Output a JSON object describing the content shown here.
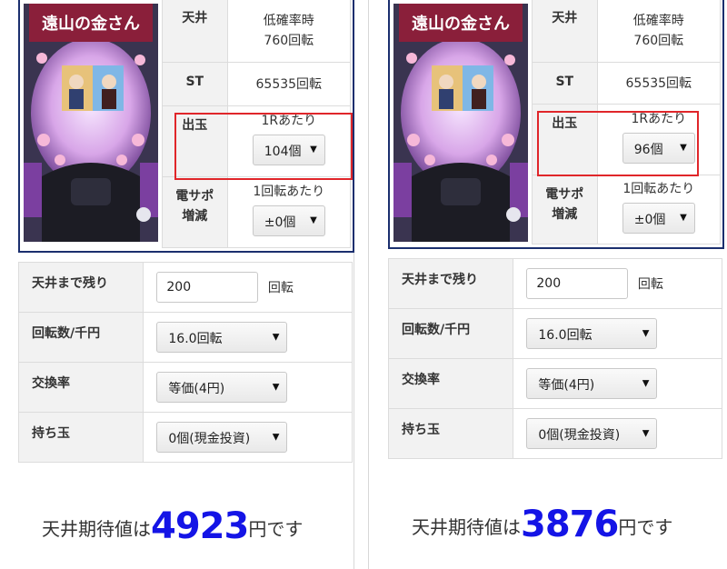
{
  "panels": [
    {
      "machine_image": "pachinko-machine-image",
      "logo_text": "遠山の金さん",
      "specs": {
        "ceiling_label": "天井",
        "ceiling_value_line1": "低確率時",
        "ceiling_value_line2": "760回転",
        "st_label": "ST",
        "st_value": "65535回転",
        "payout_label": "出玉",
        "payout_caption": "1Rあたり",
        "payout_value": "104個",
        "densapo_label_line1": "電サポ",
        "densapo_label_line2": "増減",
        "densapo_caption": "1回転あたり",
        "densapo_value": "±0個"
      },
      "calc": {
        "remaining_label": "天井まで残り",
        "remaining_value": "200",
        "remaining_unit": "回転",
        "spins_label": "回転数/千円",
        "spins_value": "16.0回転",
        "rate_label": "交換率",
        "rate_value": "等価(4円)",
        "balls_label": "持ち玉",
        "balls_value": "0個(現金投資)"
      },
      "result": {
        "prefix": "天井期待値は",
        "value": "4923",
        "suffix": "円です"
      }
    },
    {
      "machine_image": "pachinko-machine-image",
      "logo_text": "遠山の金さん",
      "specs": {
        "ceiling_label": "天井",
        "ceiling_value_line1": "低確率時",
        "ceiling_value_line2": "760回転",
        "st_label": "ST",
        "st_value": "65535回転",
        "payout_label": "出玉",
        "payout_caption": "1Rあたり",
        "payout_value": "96個",
        "densapo_label_line1": "電サポ",
        "densapo_label_line2": "増減",
        "densapo_caption": "1回転あたり",
        "densapo_value": "±0個"
      },
      "calc": {
        "remaining_label": "天井まで残り",
        "remaining_value": "200",
        "remaining_unit": "回転",
        "spins_label": "回転数/千円",
        "spins_value": "16.0回転",
        "rate_label": "交換率",
        "rate_value": "等価(4円)",
        "balls_label": "持ち玉",
        "balls_value": "0個(現金投資)"
      },
      "result": {
        "prefix": "天井期待値は",
        "value": "3876",
        "suffix": "円です"
      }
    }
  ],
  "colors": {
    "result_number": "#1414e6",
    "highlight_box": "#e0262a",
    "frame": "#1b2f6e"
  },
  "icons": {
    "select_arrow": "triangle-down-icon"
  }
}
